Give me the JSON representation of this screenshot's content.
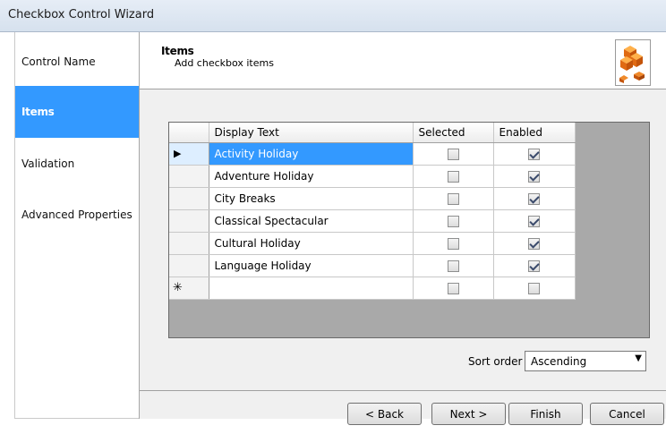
{
  "window": {
    "title": "Checkbox Control Wizard"
  },
  "sidebar": {
    "items": [
      {
        "label": "Control Name",
        "active": false
      },
      {
        "label": "Items",
        "active": true
      },
      {
        "label": "Validation",
        "active": false
      },
      {
        "label": "Advanced Properties",
        "active": false
      }
    ]
  },
  "header": {
    "title": "Items",
    "subtitle": "Add checkbox items",
    "icon": "cubes-icon"
  },
  "grid": {
    "columns": [
      "Display Text",
      "Selected",
      "Enabled"
    ],
    "rows": [
      {
        "text": "Activity Holiday",
        "selected": false,
        "enabled": true,
        "current": true
      },
      {
        "text": "Adventure Holiday",
        "selected": false,
        "enabled": true
      },
      {
        "text": "City Breaks",
        "selected": false,
        "enabled": true
      },
      {
        "text": "Classical Spectacular",
        "selected": false,
        "enabled": true
      },
      {
        "text": "Cultural Holiday",
        "selected": false,
        "enabled": true
      },
      {
        "text": "Language Holiday",
        "selected": false,
        "enabled": true
      },
      {
        "text": "",
        "selected": false,
        "enabled": false,
        "new_row": true
      }
    ],
    "current_row_marker": "▶",
    "new_row_marker": "✳"
  },
  "sort": {
    "label": "Sort order",
    "value": "Ascending"
  },
  "buttons": {
    "back": "< Back",
    "next": "Next >",
    "finish": "Finish",
    "cancel": "Cancel"
  },
  "colors": {
    "accent": "#3399ff",
    "title_bar": "#dbe5f1",
    "grid_background": "#a9a9a9"
  }
}
